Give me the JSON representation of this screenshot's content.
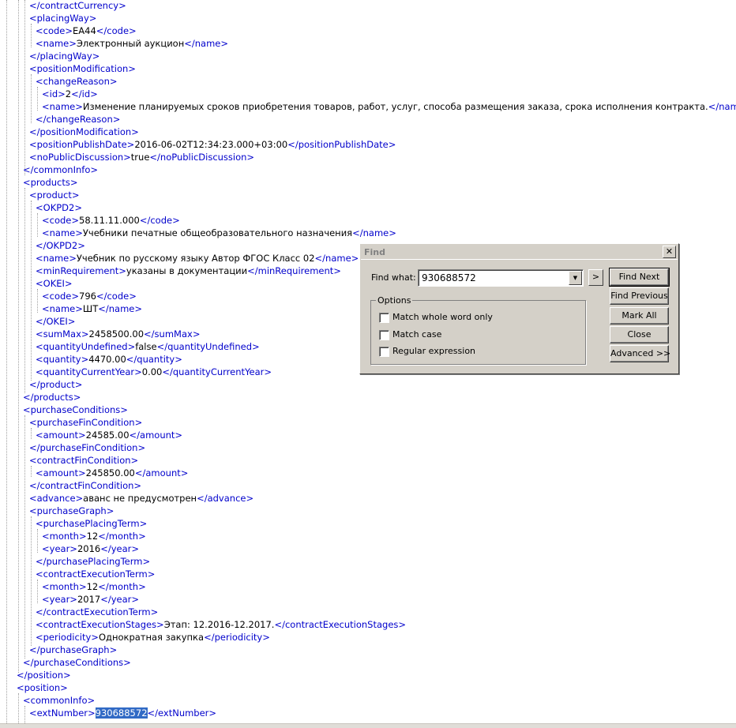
{
  "xml_lines": [
    {
      "indent": 1,
      "parts": [
        {
          "t": "</contractCurrency>",
          "k": "tag"
        }
      ]
    },
    {
      "indent": 1,
      "parts": [
        {
          "t": "<placingWay>",
          "k": "tag"
        }
      ]
    },
    {
      "indent": 2,
      "parts": [
        {
          "t": "<code>",
          "k": "tag"
        },
        {
          "t": "EA44",
          "k": "txt"
        },
        {
          "t": "</code>",
          "k": "tag"
        }
      ]
    },
    {
      "indent": 2,
      "parts": [
        {
          "t": "<name>",
          "k": "tag"
        },
        {
          "t": "Электронный аукцион",
          "k": "txt"
        },
        {
          "t": "</name>",
          "k": "tag"
        }
      ]
    },
    {
      "indent": 1,
      "parts": [
        {
          "t": "</placingWay>",
          "k": "tag"
        }
      ]
    },
    {
      "indent": 1,
      "parts": [
        {
          "t": "<positionModification>",
          "k": "tag"
        }
      ]
    },
    {
      "indent": 2,
      "parts": [
        {
          "t": "<changeReason>",
          "k": "tag"
        }
      ]
    },
    {
      "indent": 3,
      "parts": [
        {
          "t": "<id>",
          "k": "tag"
        },
        {
          "t": "2",
          "k": "txt"
        },
        {
          "t": "</id>",
          "k": "tag"
        }
      ]
    },
    {
      "indent": 3,
      "parts": [
        {
          "t": "<name>",
          "k": "tag"
        },
        {
          "t": "Изменение планируемых сроков приобретения товаров, работ, услуг, способа размещения заказа, срока исполнения контракта.",
          "k": "txt"
        },
        {
          "t": "</name>",
          "k": "tag"
        }
      ]
    },
    {
      "indent": 2,
      "parts": [
        {
          "t": "</changeReason>",
          "k": "tag"
        }
      ]
    },
    {
      "indent": 1,
      "parts": [
        {
          "t": "</positionModification>",
          "k": "tag"
        }
      ]
    },
    {
      "indent": 1,
      "parts": [
        {
          "t": "<positionPublishDate>",
          "k": "tag"
        },
        {
          "t": "2016-06-02T12:34:23.000+03:00",
          "k": "txt"
        },
        {
          "t": "</positionPublishDate>",
          "k": "tag"
        }
      ]
    },
    {
      "indent": 1,
      "parts": [
        {
          "t": "<noPublicDiscussion>",
          "k": "tag"
        },
        {
          "t": "true",
          "k": "txt"
        },
        {
          "t": "</noPublicDiscussion>",
          "k": "tag"
        }
      ]
    },
    {
      "indent": 0,
      "parts": [
        {
          "t": "</commonInfo>",
          "k": "tag"
        }
      ]
    },
    {
      "indent": 0,
      "parts": [
        {
          "t": "<products>",
          "k": "tag"
        }
      ]
    },
    {
      "indent": 1,
      "parts": [
        {
          "t": "<product>",
          "k": "tag"
        }
      ]
    },
    {
      "indent": 2,
      "parts": [
        {
          "t": "<OKPD2>",
          "k": "tag"
        }
      ]
    },
    {
      "indent": 3,
      "parts": [
        {
          "t": "<code>",
          "k": "tag"
        },
        {
          "t": "58.11.11.000",
          "k": "txt"
        },
        {
          "t": "</code>",
          "k": "tag"
        }
      ]
    },
    {
      "indent": 3,
      "parts": [
        {
          "t": "<name>",
          "k": "tag"
        },
        {
          "t": "Учебники печатные общеобразовательного назначения",
          "k": "txt"
        },
        {
          "t": "</name>",
          "k": "tag"
        }
      ]
    },
    {
      "indent": 2,
      "parts": [
        {
          "t": "</OKPD2>",
          "k": "tag"
        }
      ]
    },
    {
      "indent": 2,
      "parts": [
        {
          "t": "<name>",
          "k": "tag"
        },
        {
          "t": "Учебник по русскому языку Автор ФГОС Класс 02",
          "k": "txt"
        },
        {
          "t": "</name>",
          "k": "tag"
        }
      ]
    },
    {
      "indent": 2,
      "parts": [
        {
          "t": "<minRequirement>",
          "k": "tag"
        },
        {
          "t": "указаны в документации",
          "k": "txt"
        },
        {
          "t": "</minRequirement>",
          "k": "tag"
        }
      ]
    },
    {
      "indent": 2,
      "parts": [
        {
          "t": "<OKEI>",
          "k": "tag"
        }
      ]
    },
    {
      "indent": 3,
      "parts": [
        {
          "t": "<code>",
          "k": "tag"
        },
        {
          "t": "796",
          "k": "txt"
        },
        {
          "t": "</code>",
          "k": "tag"
        }
      ]
    },
    {
      "indent": 3,
      "parts": [
        {
          "t": "<name>",
          "k": "tag"
        },
        {
          "t": "ШТ",
          "k": "txt"
        },
        {
          "t": "</name>",
          "k": "tag"
        }
      ]
    },
    {
      "indent": 2,
      "parts": [
        {
          "t": "</OKEI>",
          "k": "tag"
        }
      ]
    },
    {
      "indent": 2,
      "parts": [
        {
          "t": "<sumMax>",
          "k": "tag"
        },
        {
          "t": "2458500.00",
          "k": "txt"
        },
        {
          "t": "</sumMax>",
          "k": "tag"
        }
      ]
    },
    {
      "indent": 2,
      "parts": [
        {
          "t": "<quantityUndefined>",
          "k": "tag"
        },
        {
          "t": "false",
          "k": "txt"
        },
        {
          "t": "</quantityUndefined>",
          "k": "tag"
        }
      ]
    },
    {
      "indent": 2,
      "parts": [
        {
          "t": "<quantity>",
          "k": "tag"
        },
        {
          "t": "4470.00",
          "k": "txt"
        },
        {
          "t": "</quantity>",
          "k": "tag"
        }
      ]
    },
    {
      "indent": 2,
      "parts": [
        {
          "t": "<quantityCurrentYear>",
          "k": "tag"
        },
        {
          "t": "0.00",
          "k": "txt"
        },
        {
          "t": "</quantityCurrentYear>",
          "k": "tag"
        }
      ]
    },
    {
      "indent": 1,
      "parts": [
        {
          "t": "</product>",
          "k": "tag"
        }
      ]
    },
    {
      "indent": 0,
      "parts": [
        {
          "t": "</products>",
          "k": "tag"
        }
      ]
    },
    {
      "indent": 0,
      "parts": [
        {
          "t": "<purchaseConditions>",
          "k": "tag"
        }
      ]
    },
    {
      "indent": 1,
      "parts": [
        {
          "t": "<purchaseFinCondition>",
          "k": "tag"
        }
      ]
    },
    {
      "indent": 2,
      "parts": [
        {
          "t": "<amount>",
          "k": "tag"
        },
        {
          "t": "24585.00",
          "k": "txt"
        },
        {
          "t": "</amount>",
          "k": "tag"
        }
      ]
    },
    {
      "indent": 1,
      "parts": [
        {
          "t": "</purchaseFinCondition>",
          "k": "tag"
        }
      ]
    },
    {
      "indent": 1,
      "parts": [
        {
          "t": "<contractFinCondition>",
          "k": "tag"
        }
      ]
    },
    {
      "indent": 2,
      "parts": [
        {
          "t": "<amount>",
          "k": "tag"
        },
        {
          "t": "245850.00",
          "k": "txt"
        },
        {
          "t": "</amount>",
          "k": "tag"
        }
      ]
    },
    {
      "indent": 1,
      "parts": [
        {
          "t": "</contractFinCondition>",
          "k": "tag"
        }
      ]
    },
    {
      "indent": 1,
      "parts": [
        {
          "t": "<advance>",
          "k": "tag"
        },
        {
          "t": "аванс не предусмотрен",
          "k": "txt"
        },
        {
          "t": "</advance>",
          "k": "tag"
        }
      ]
    },
    {
      "indent": 1,
      "parts": [
        {
          "t": "<purchaseGraph>",
          "k": "tag"
        }
      ]
    },
    {
      "indent": 2,
      "parts": [
        {
          "t": "<purchasePlacingTerm>",
          "k": "tag"
        }
      ]
    },
    {
      "indent": 3,
      "parts": [
        {
          "t": "<month>",
          "k": "tag"
        },
        {
          "t": "12",
          "k": "txt"
        },
        {
          "t": "</month>",
          "k": "tag"
        }
      ]
    },
    {
      "indent": 3,
      "parts": [
        {
          "t": "<year>",
          "k": "tag"
        },
        {
          "t": "2016",
          "k": "txt"
        },
        {
          "t": "</year>",
          "k": "tag"
        }
      ]
    },
    {
      "indent": 2,
      "parts": [
        {
          "t": "</purchasePlacingTerm>",
          "k": "tag"
        }
      ]
    },
    {
      "indent": 2,
      "parts": [
        {
          "t": "<contractExecutionTerm>",
          "k": "tag"
        }
      ]
    },
    {
      "indent": 3,
      "parts": [
        {
          "t": "<month>",
          "k": "tag"
        },
        {
          "t": "12",
          "k": "txt"
        },
        {
          "t": "</month>",
          "k": "tag"
        }
      ]
    },
    {
      "indent": 3,
      "parts": [
        {
          "t": "<year>",
          "k": "tag"
        },
        {
          "t": "2017",
          "k": "txt"
        },
        {
          "t": "</year>",
          "k": "tag"
        }
      ]
    },
    {
      "indent": 2,
      "parts": [
        {
          "t": "</contractExecutionTerm>",
          "k": "tag"
        }
      ]
    },
    {
      "indent": 2,
      "parts": [
        {
          "t": "<contractExecutionStages>",
          "k": "tag"
        },
        {
          "t": "Этап: 12.2016-12.2017.",
          "k": "txt"
        },
        {
          "t": "</contractExecutionStages>",
          "k": "tag"
        }
      ]
    },
    {
      "indent": 2,
      "parts": [
        {
          "t": "<periodicity>",
          "k": "tag"
        },
        {
          "t": "Однократная закупка",
          "k": "txt"
        },
        {
          "t": "</periodicity>",
          "k": "tag"
        }
      ]
    },
    {
      "indent": 1,
      "parts": [
        {
          "t": "</purchaseGraph>",
          "k": "tag"
        }
      ]
    },
    {
      "indent": 0,
      "parts": [
        {
          "t": "</purchaseConditions>",
          "k": "tag"
        }
      ]
    },
    {
      "indent": -1,
      "parts": [
        {
          "t": "</position>",
          "k": "tag"
        }
      ]
    },
    {
      "indent": -1,
      "parts": [
        {
          "t": "<position>",
          "k": "tag"
        }
      ]
    },
    {
      "indent": 0,
      "parts": [
        {
          "t": "<commonInfo>",
          "k": "tag"
        }
      ]
    },
    {
      "indent": 1,
      "parts": [
        {
          "t": "<extNumber>",
          "k": "tag"
        },
        {
          "t": "930688572",
          "k": "hl"
        },
        {
          "t": "</extNumber>",
          "k": "tag"
        }
      ]
    }
  ],
  "find_dialog": {
    "title": "Find",
    "close_glyph": "✕",
    "find_what_label": "Find what:",
    "find_what_value": "930688572",
    "dropdown_glyph": "▼",
    "arrow_glyph": ">",
    "options_title": "Options",
    "options": [
      {
        "label": "Match whole word only",
        "checked": false
      },
      {
        "label": "Match case",
        "checked": false
      },
      {
        "label": "Regular expression",
        "checked": false
      }
    ],
    "buttons": {
      "find_next": "Find Next",
      "find_previous": "Find Previous",
      "mark_all": "Mark All",
      "close": "Close",
      "advanced": "Advanced >>"
    }
  }
}
